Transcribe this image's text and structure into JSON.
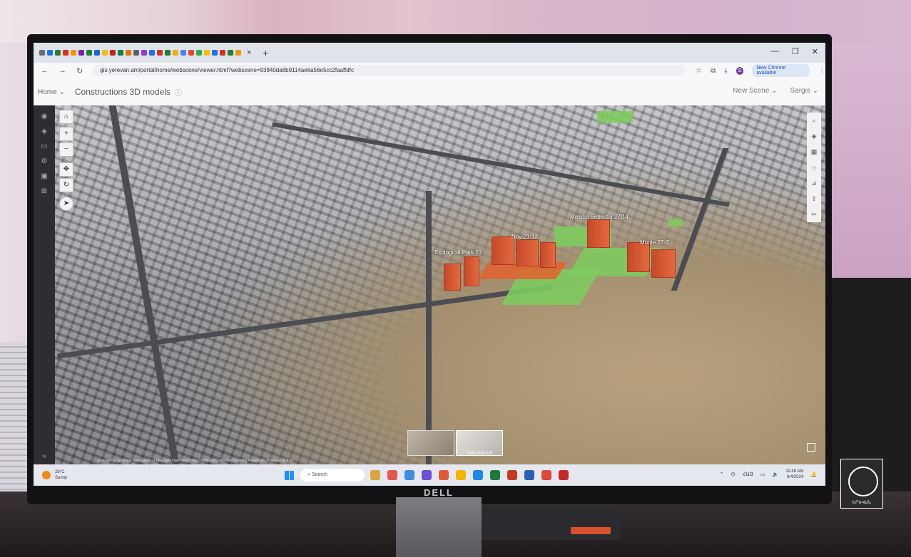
{
  "browser": {
    "tab_colors": [
      "#6d6d6d",
      "#1a73e8",
      "#2e7d32",
      "#d93025",
      "#f29900",
      "#7b1fa2",
      "#188038",
      "#1967d2",
      "#fbbc04",
      "#c5221f",
      "#0b8043",
      "#e37400",
      "#5f6368",
      "#9334e6",
      "#1a73e8",
      "#d93025",
      "#188038",
      "#f9ab00",
      "#4285f4",
      "#ea4335",
      "#34a853",
      "#fbbc05",
      "#1a73e8",
      "#d93025",
      "#188038",
      "#f29900"
    ],
    "tab_close": "×",
    "new_tab": "+",
    "window_controls": [
      "—",
      "❐",
      "✕"
    ],
    "url": "gis.yerevan.am/portal/home/webscene/viewer.html?webscene=93840da8b9114ae6a56e5cc2faaffdfc",
    "profile_initial": "S",
    "new_chrome_label": "New Chrome available"
  },
  "app": {
    "home_label": "Home",
    "title": "Constructions 3D models",
    "new_scene_label": "New Scene",
    "user_label": "Sargis"
  },
  "scene": {
    "labels": [
      "Malaba Sebastia 27/14",
      "Noy 21-13",
      "Ecological Park 21",
      "Monte 27-7"
    ],
    "thumbnail_caption": "Ավելացված",
    "attribution": "Esri, Maxar, Earthstar Geographics | Map data OpenStreetMap contributors, Microsoft Building Footprints | Powered by Esri"
  },
  "taskbar": {
    "weather_temp": "28°C",
    "weather_desc": "Sunny",
    "search_placeholder": "Search",
    "app_colors": [
      "#d9a441",
      "#e2584a",
      "#3c8dde",
      "#6b4fd4",
      "#e15a3a",
      "#f4b400",
      "#1e88e5",
      "#1f7a3a",
      "#c23b22",
      "#2b5fb5",
      "#db4a3a",
      "#c62828"
    ],
    "language": "ՀԱՅ",
    "time": "11:48 AM",
    "date": "9/4/2024"
  },
  "logo": {
    "caption": "ԵՐԵՎԱՆ"
  }
}
